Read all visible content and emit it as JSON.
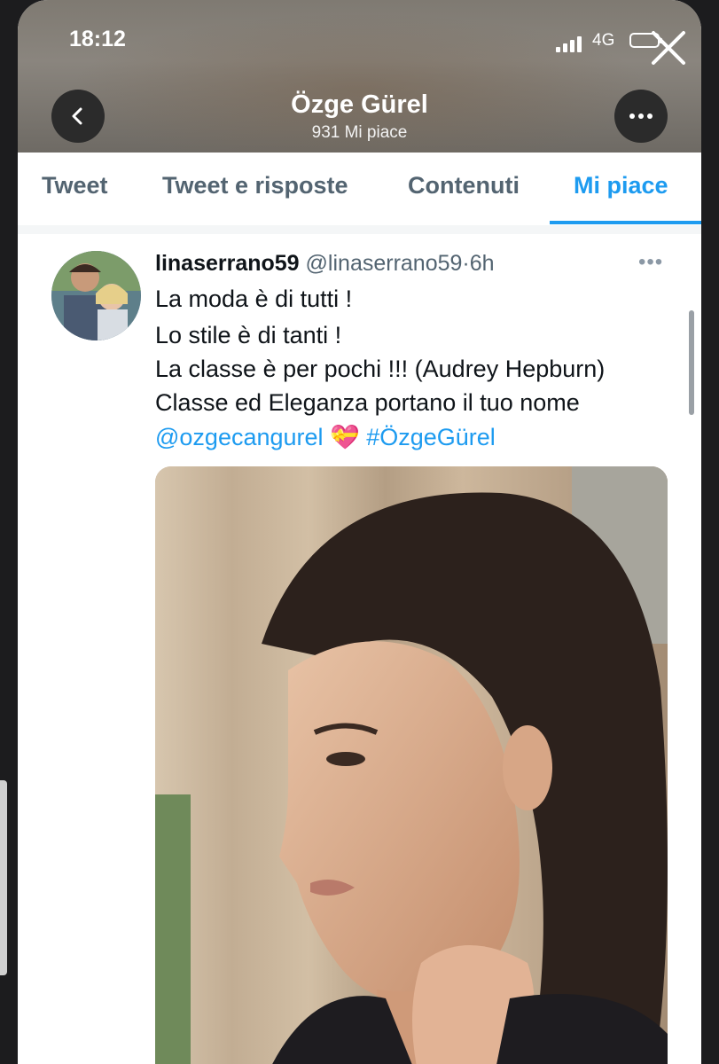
{
  "status_bar": {
    "time": "18:12",
    "network": "4G"
  },
  "header": {
    "title": "Özge Gürel",
    "subtitle": "931 Mi piace"
  },
  "tabs": [
    {
      "label": "Tweet"
    },
    {
      "label": "Tweet e risposte"
    },
    {
      "label": "Contenuti"
    },
    {
      "label": "Mi piace",
      "active": true
    }
  ],
  "tweet": {
    "username": "linaserrano59",
    "handle": "@linaserrano59",
    "separator": "·",
    "time": "6h",
    "lines": [
      "La moda è di tutti !",
      "Lo stile è di tanti !",
      "La classe è per pochi !!! (Audrey Hepburn)",
      "Classe ed Eleganza portano il tuo nome"
    ],
    "mention": "@ozgecangurel",
    "emoji": "💝",
    "hashtag": "#ÖzgeGürel"
  },
  "colors": {
    "accent": "#1d9bf0",
    "text": "#0f1419",
    "muted": "#536471"
  }
}
